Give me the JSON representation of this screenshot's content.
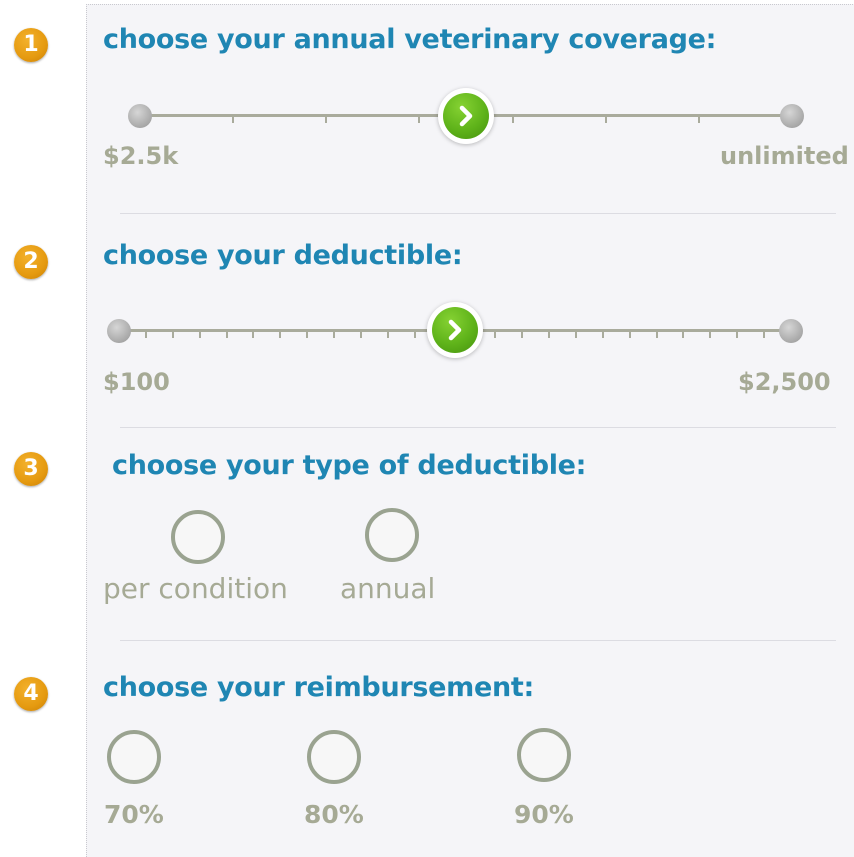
{
  "steps": [
    {
      "number": "1",
      "heading": "choose your annual veterinary coverage:"
    },
    {
      "number": "2",
      "heading": "choose your deductible:"
    },
    {
      "number": "3",
      "heading": "choose your type of deductible:"
    },
    {
      "number": "4",
      "heading": "choose your reimbursement:"
    }
  ],
  "coverage_slider": {
    "min_label": "$2.5k",
    "max_label": "unlimited",
    "tick_count": 6,
    "position": 0.5
  },
  "deductible_slider": {
    "min_label": "$100",
    "max_label": "$2,500",
    "tick_count": 24,
    "position": 0.5
  },
  "deductible_type": {
    "options": [
      {
        "label": "per condition",
        "selected": false
      },
      {
        "label": "annual",
        "selected": false
      }
    ]
  },
  "reimbursement": {
    "options": [
      {
        "label": "70%",
        "selected": false
      },
      {
        "label": "80%",
        "selected": false
      },
      {
        "label": "90%",
        "selected": false
      }
    ]
  },
  "colors": {
    "heading": "#1f86b3",
    "step_badge": "#e59a10",
    "knob": "#5fb31a",
    "muted_label": "#a6aa95"
  }
}
